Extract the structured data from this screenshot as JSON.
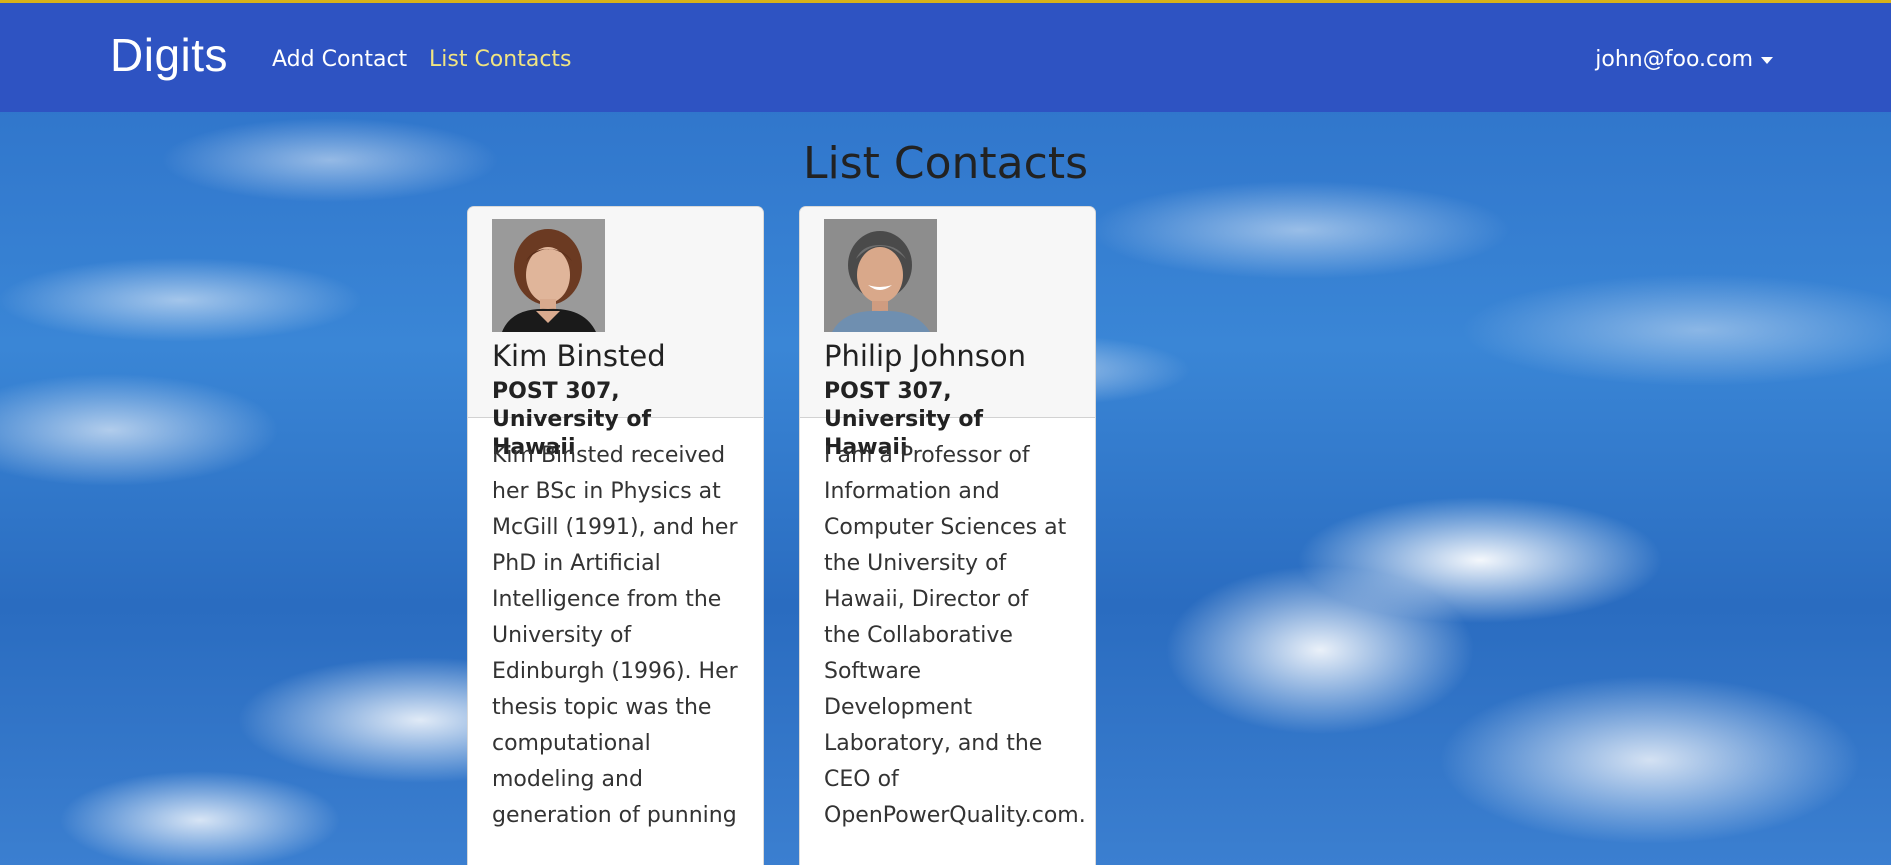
{
  "navbar": {
    "brand": "Digits",
    "links": [
      {
        "label": "Add Contact"
      },
      {
        "label": "List Contacts"
      }
    ],
    "user": "john@foo.com"
  },
  "page": {
    "title": "List Contacts"
  },
  "contacts": [
    {
      "name": "Kim Binsted",
      "address": "POST 307, University of Hawaii",
      "description": "Kim Binsted received her BSc in Physics at McGill (1991), and her PhD in Artificial Intelligence from the University of Edinburgh (1996). Her thesis topic was the computational modeling and generation of punning"
    },
    {
      "name": "Philip Johnson",
      "address": "POST 307, University of Hawaii",
      "description": "I am a Professor of Information and Computer Sciences at the University of Hawaii, Director of the Collaborative Software Development Laboratory, and the CEO of OpenPowerQuality.com."
    }
  ],
  "colors": {
    "navbar": "#2e53c2",
    "active_link": "#f0e482",
    "top_accent": "#d7b21a"
  }
}
